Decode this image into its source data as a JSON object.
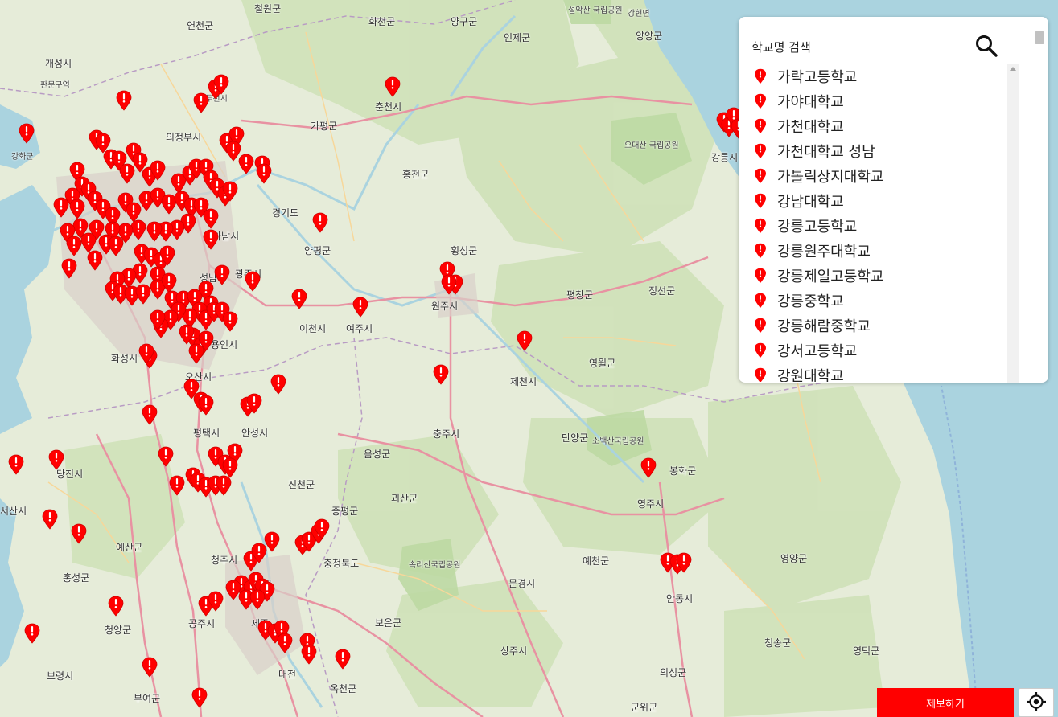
{
  "map": {
    "labels": [
      {
        "text": "철원군",
        "cls": "big"
      },
      {
        "text": "화천군",
        "cls": "big"
      },
      {
        "text": "양구군",
        "cls": "big"
      },
      {
        "text": "인제군",
        "cls": "big"
      },
      {
        "text": "양양군",
        "cls": "big"
      },
      {
        "text": "강현면",
        "cls": ""
      },
      {
        "text": "개성시",
        "cls": "big"
      },
      {
        "text": "판문구역",
        "cls": ""
      },
      {
        "text": "연천군",
        "cls": "big"
      },
      {
        "text": "동두천시",
        "cls": ""
      },
      {
        "text": "춘천시",
        "cls": "big"
      },
      {
        "text": "가평군",
        "cls": "big"
      },
      {
        "text": "홍천군",
        "cls": "big"
      },
      {
        "text": "의정부시",
        "cls": "big"
      },
      {
        "text": "강화군",
        "cls": ""
      },
      {
        "text": "경기도",
        "cls": "big"
      },
      {
        "text": "양평군",
        "cls": "big"
      },
      {
        "text": "횡성군",
        "cls": "big"
      },
      {
        "text": "평창군",
        "cls": "big"
      },
      {
        "text": "하남시",
        "cls": "big"
      },
      {
        "text": "광주시",
        "cls": "big"
      },
      {
        "text": "원주시",
        "cls": "big"
      },
      {
        "text": "정선군",
        "cls": "big"
      },
      {
        "text": "성남시",
        "cls": "big"
      },
      {
        "text": "이천시",
        "cls": "big"
      },
      {
        "text": "여주시",
        "cls": "big"
      },
      {
        "text": "영월군",
        "cls": "big"
      },
      {
        "text": "화성시",
        "cls": "big"
      },
      {
        "text": "용인시",
        "cls": "big"
      },
      {
        "text": "오산시",
        "cls": "big"
      },
      {
        "text": "제천시",
        "cls": "big"
      },
      {
        "text": "평택시",
        "cls": "big"
      },
      {
        "text": "안성시",
        "cls": "big"
      },
      {
        "text": "충주시",
        "cls": "big"
      },
      {
        "text": "음성군",
        "cls": "big"
      },
      {
        "text": "단양군",
        "cls": "big"
      },
      {
        "text": "봉화군",
        "cls": "big"
      },
      {
        "text": "진천군",
        "cls": "big"
      },
      {
        "text": "괴산군",
        "cls": "big"
      },
      {
        "text": "영주시",
        "cls": "big"
      },
      {
        "text": "서산시",
        "cls": "big"
      },
      {
        "text": "당진시",
        "cls": "big"
      },
      {
        "text": "증평군",
        "cls": "big"
      },
      {
        "text": "예산군",
        "cls": "big"
      },
      {
        "text": "홍성군",
        "cls": "big"
      },
      {
        "text": "청주시",
        "cls": "big"
      },
      {
        "text": "충청북도",
        "cls": "big"
      },
      {
        "text": "예천군",
        "cls": "big"
      },
      {
        "text": "안동시",
        "cls": "big"
      },
      {
        "text": "영양군",
        "cls": "big"
      },
      {
        "text": "문경시",
        "cls": "big"
      },
      {
        "text": "청양군",
        "cls": "big"
      },
      {
        "text": "공주시",
        "cls": "big"
      },
      {
        "text": "세종",
        "cls": "big"
      },
      {
        "text": "보은군",
        "cls": "big"
      },
      {
        "text": "상주시",
        "cls": "big"
      },
      {
        "text": "청송군",
        "cls": "big"
      },
      {
        "text": "영덕군",
        "cls": "big"
      },
      {
        "text": "보령시",
        "cls": "big"
      },
      {
        "text": "부여군",
        "cls": "big"
      },
      {
        "text": "대전",
        "cls": "big"
      },
      {
        "text": "옥천군",
        "cls": "big"
      },
      {
        "text": "의성군",
        "cls": "big"
      },
      {
        "text": "군위군",
        "cls": "big"
      },
      {
        "text": "강릉시",
        "cls": "big"
      },
      {
        "text": "오대산 국립공원",
        "cls": ""
      },
      {
        "text": "설악산 국립공원",
        "cls": ""
      },
      {
        "text": "소백산국립공원",
        "cls": ""
      },
      {
        "text": "속리산국립공원",
        "cls": ""
      },
      {
        "text": "세종특별자",
        "cls": ""
      }
    ]
  },
  "search": {
    "label": "학교명 검색",
    "button_icon": "search-icon",
    "schools": [
      "가락고등학교",
      "가야대학교",
      "가천대학교",
      "가천대학교 성남",
      "가톨릭상지대학교",
      "강남대학교",
      "강릉고등학교",
      "강릉원주대학교",
      "강릉제일고등학교",
      "강릉중학교",
      "강릉해람중학교",
      "강서고등학교",
      "강원대학교"
    ]
  },
  "report_button": {
    "label": "제보하기"
  },
  "locate_button": {
    "icon": "crosshair-icon"
  },
  "colors": {
    "marker": "#ff0000",
    "sea": "#aad3df",
    "land": "#e6ecd9",
    "forest": "#c8dfb0",
    "highway": "#e892a2"
  }
}
